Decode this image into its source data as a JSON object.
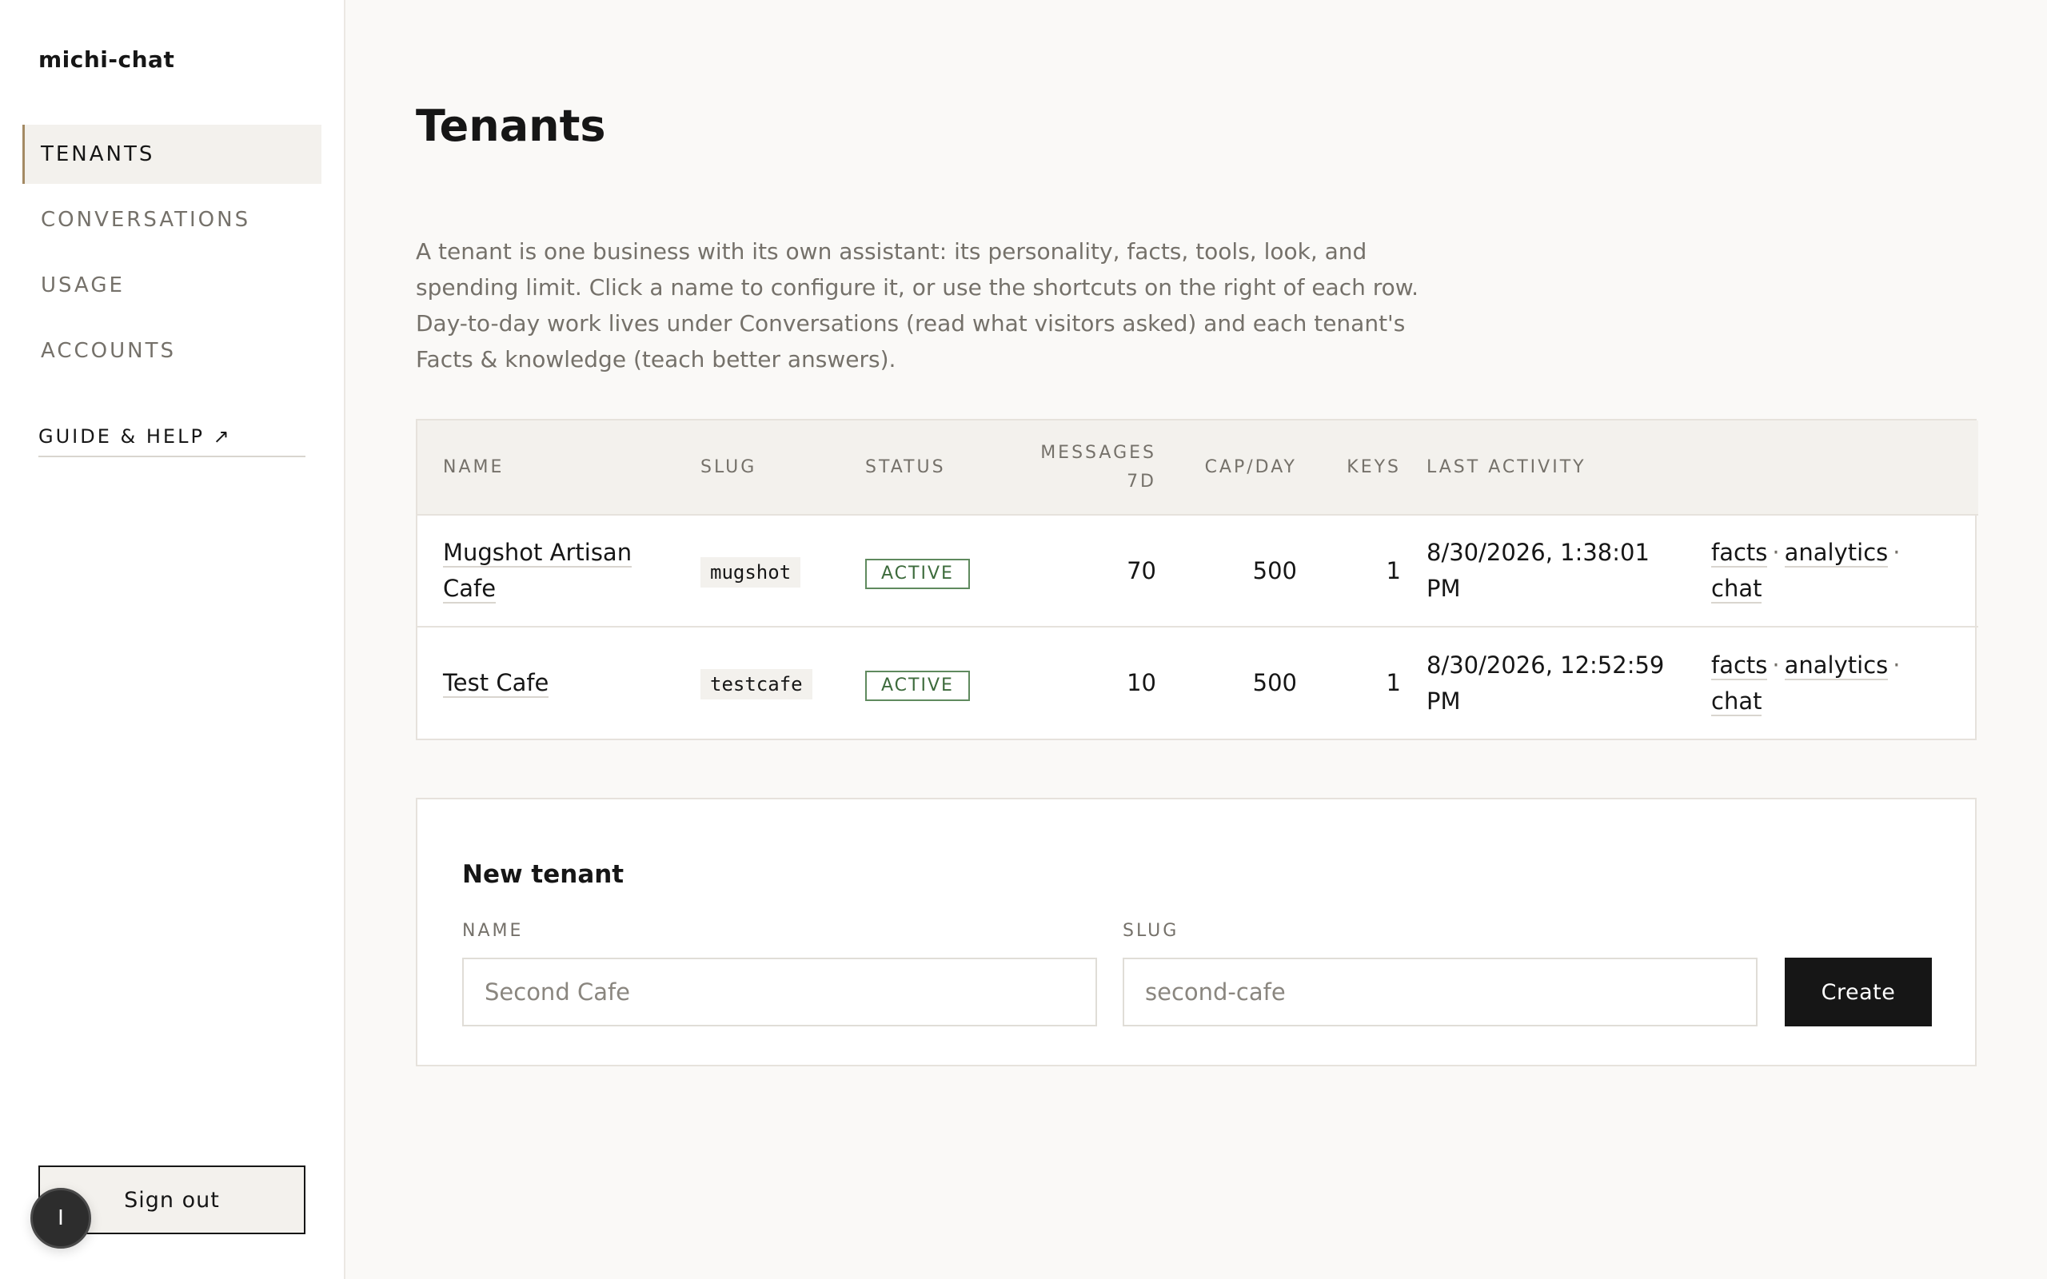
{
  "app": {
    "brand": "michi-chat"
  },
  "sidebar": {
    "items": [
      {
        "label": "TENANTS",
        "active": true
      },
      {
        "label": "CONVERSATIONS"
      },
      {
        "label": "USAGE"
      },
      {
        "label": "ACCOUNTS"
      }
    ],
    "guide_link": "GUIDE & HELP ↗",
    "signout_label": "Sign out",
    "avatar_initial": "I"
  },
  "main": {
    "title": "Tenants",
    "intro": "A tenant is one business with its own assistant: its personality, facts, tools, look, and spending limit. Click a name to configure it, or use the shortcuts on the right of each row. Day-to-day work lives under Conversations (read what visitors asked) and each tenant's Facts & knowledge (teach better answers).",
    "table": {
      "headers": [
        "NAME",
        "SLUG",
        "STATUS",
        "MESSAGES 7D",
        "CAP/DAY",
        "KEYS",
        "LAST ACTIVITY",
        ""
      ],
      "rows": [
        {
          "name": "Mugshot Artisan Cafe",
          "slug": "mugshot",
          "status": "ACTIVE",
          "messages_7d": "70",
          "cap_day": "500",
          "keys": "1",
          "last_activity": "8/30/2026, 1:38:01 PM",
          "shortcuts": [
            "facts",
            "analytics",
            "chat"
          ]
        },
        {
          "name": "Test Cafe",
          "slug": "testcafe",
          "status": "ACTIVE",
          "messages_7d": "10",
          "cap_day": "500",
          "keys": "1",
          "last_activity": "8/30/2026, 12:52:59 PM",
          "shortcuts": [
            "facts",
            "analytics",
            "chat"
          ]
        }
      ]
    },
    "new_tenant": {
      "title": "New tenant",
      "name_label": "NAME",
      "name_placeholder": "Second Cafe",
      "slug_label": "SLUG",
      "slug_placeholder": "second-cafe",
      "create_label": "Create"
    }
  },
  "colors": {
    "background": "#faf9f7",
    "accent": "#a48a63",
    "status_active": "#3d6b3c",
    "primary_button": "#161616"
  }
}
